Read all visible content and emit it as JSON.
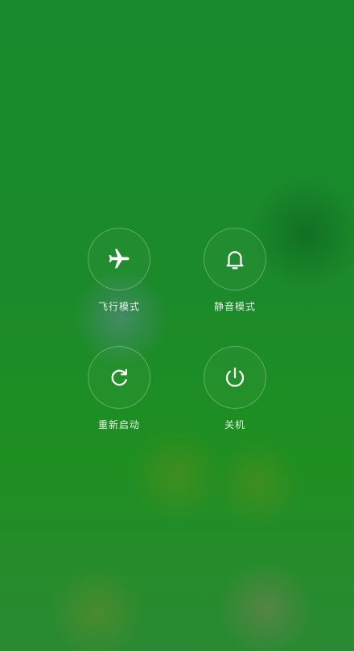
{
  "power_menu": {
    "options": [
      {
        "id": "airplane",
        "label": "飞行模式",
        "icon": "airplane-icon"
      },
      {
        "id": "silent",
        "label": "静音模式",
        "icon": "bell-icon"
      },
      {
        "id": "restart",
        "label": "重新启动",
        "icon": "restart-icon"
      },
      {
        "id": "power_off",
        "label": "关机",
        "icon": "power-icon"
      }
    ]
  },
  "colors": {
    "background": "#1a8a2c",
    "foreground": "#ffffff"
  }
}
